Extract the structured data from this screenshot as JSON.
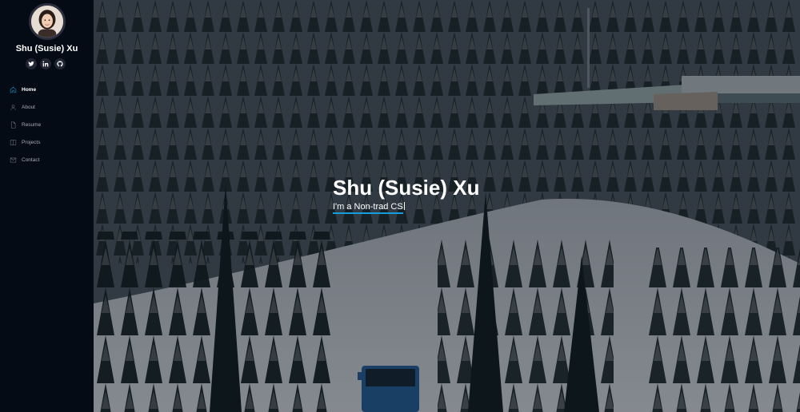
{
  "profile": {
    "name": "Shu (Susie) Xu"
  },
  "socials": [
    {
      "icon": "twitter-icon"
    },
    {
      "icon": "linkedin-icon"
    },
    {
      "icon": "github-icon"
    }
  ],
  "nav": {
    "items": [
      {
        "label": "Home",
        "icon": "home-icon",
        "active": true
      },
      {
        "label": "About",
        "icon": "user-icon",
        "active": false
      },
      {
        "label": "Resume",
        "icon": "file-icon",
        "active": false
      },
      {
        "label": "Projects",
        "icon": "book-icon",
        "active": false
      },
      {
        "label": "Contact",
        "icon": "envelope-icon",
        "active": false
      }
    ]
  },
  "hero": {
    "title": "Shu (Susie) Xu",
    "subtitle": "I'm a Non-trad CS",
    "background": "snowy-forest-photo"
  },
  "colors": {
    "sidebar_bg": "#040b14",
    "accent": "#149ddd",
    "social_bg": "#212431"
  }
}
